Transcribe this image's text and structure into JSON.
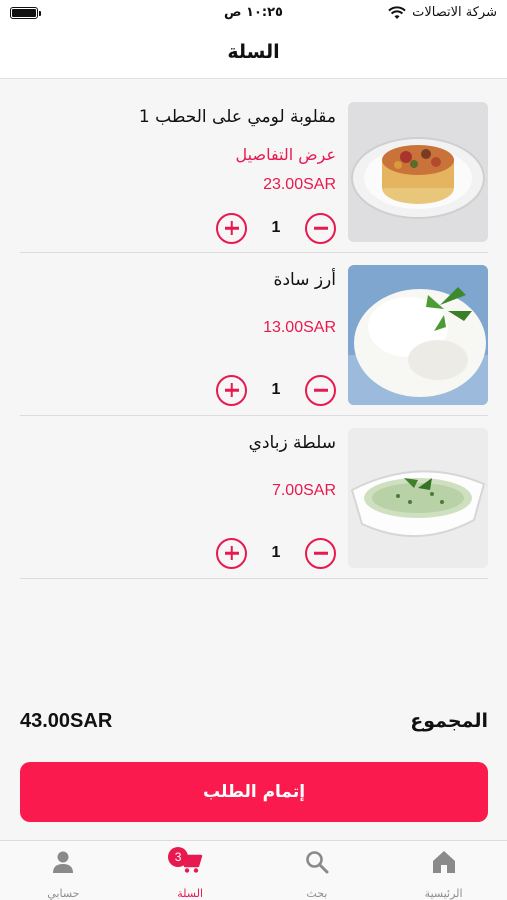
{
  "status_bar": {
    "carrier": "شركة الاتصالات",
    "time": "١٠:٢٥ ص"
  },
  "header": {
    "title": "السلة"
  },
  "items": [
    {
      "name": "مقلوبة لومي على الحطب 1",
      "details_link": "عرض التفاصيل",
      "price": "23.00SAR",
      "quantity": "1",
      "image": "maqluba-plate"
    },
    {
      "name": "أرز سادة",
      "price": "13.00SAR",
      "quantity": "1",
      "image": "white-rice-mint"
    },
    {
      "name": "سلطة زبادي",
      "price": "7.00SAR",
      "quantity": "1",
      "image": "yogurt-salad-bowl"
    }
  ],
  "summary": {
    "total_label": "المجموع",
    "total_amount": "43.00SAR"
  },
  "checkout": {
    "label": "إتمام الطلب"
  },
  "tabbar": {
    "tabs": [
      {
        "label": "حسابي",
        "icon": "person-icon"
      },
      {
        "label": "السلة",
        "icon": "cart-icon",
        "badge": "3",
        "active": true
      },
      {
        "label": "بحث",
        "icon": "search-icon"
      },
      {
        "label": "الرئيسية",
        "icon": "home-icon"
      }
    ]
  },
  "colors": {
    "accent": "#e8194f",
    "button": "#fa1a4d",
    "background": "#f6f6f6"
  }
}
